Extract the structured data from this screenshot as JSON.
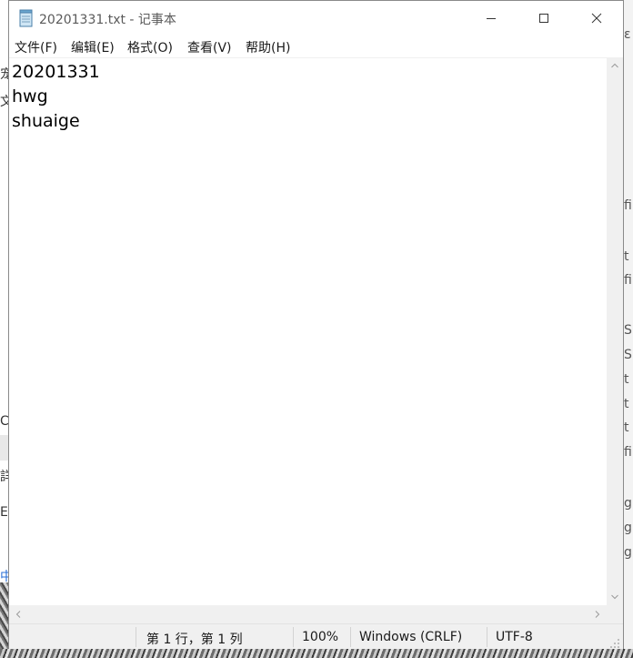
{
  "window": {
    "title": "20201331.txt - 记事本",
    "controls": {
      "minimize_icon": "minimize-icon",
      "maximize_icon": "maximize-icon",
      "close_icon": "close-icon"
    }
  },
  "menu": {
    "items": [
      {
        "label": "文件(F)"
      },
      {
        "label": "编辑(E)"
      },
      {
        "label": "格式(O)"
      },
      {
        "label": "查看(V)"
      },
      {
        "label": "帮助(H)"
      }
    ]
  },
  "editor": {
    "lines": [
      "20201331",
      "hwg",
      "shuaige"
    ]
  },
  "status": {
    "position": "第 1 行，第 1 列",
    "zoom": "100%",
    "line_ending": "Windows (CRLF)",
    "encoding": "UTF-8"
  },
  "colors": {
    "window_bg": "#ffffff",
    "bars_bg": "#f0f0f0",
    "text": "#000000"
  }
}
